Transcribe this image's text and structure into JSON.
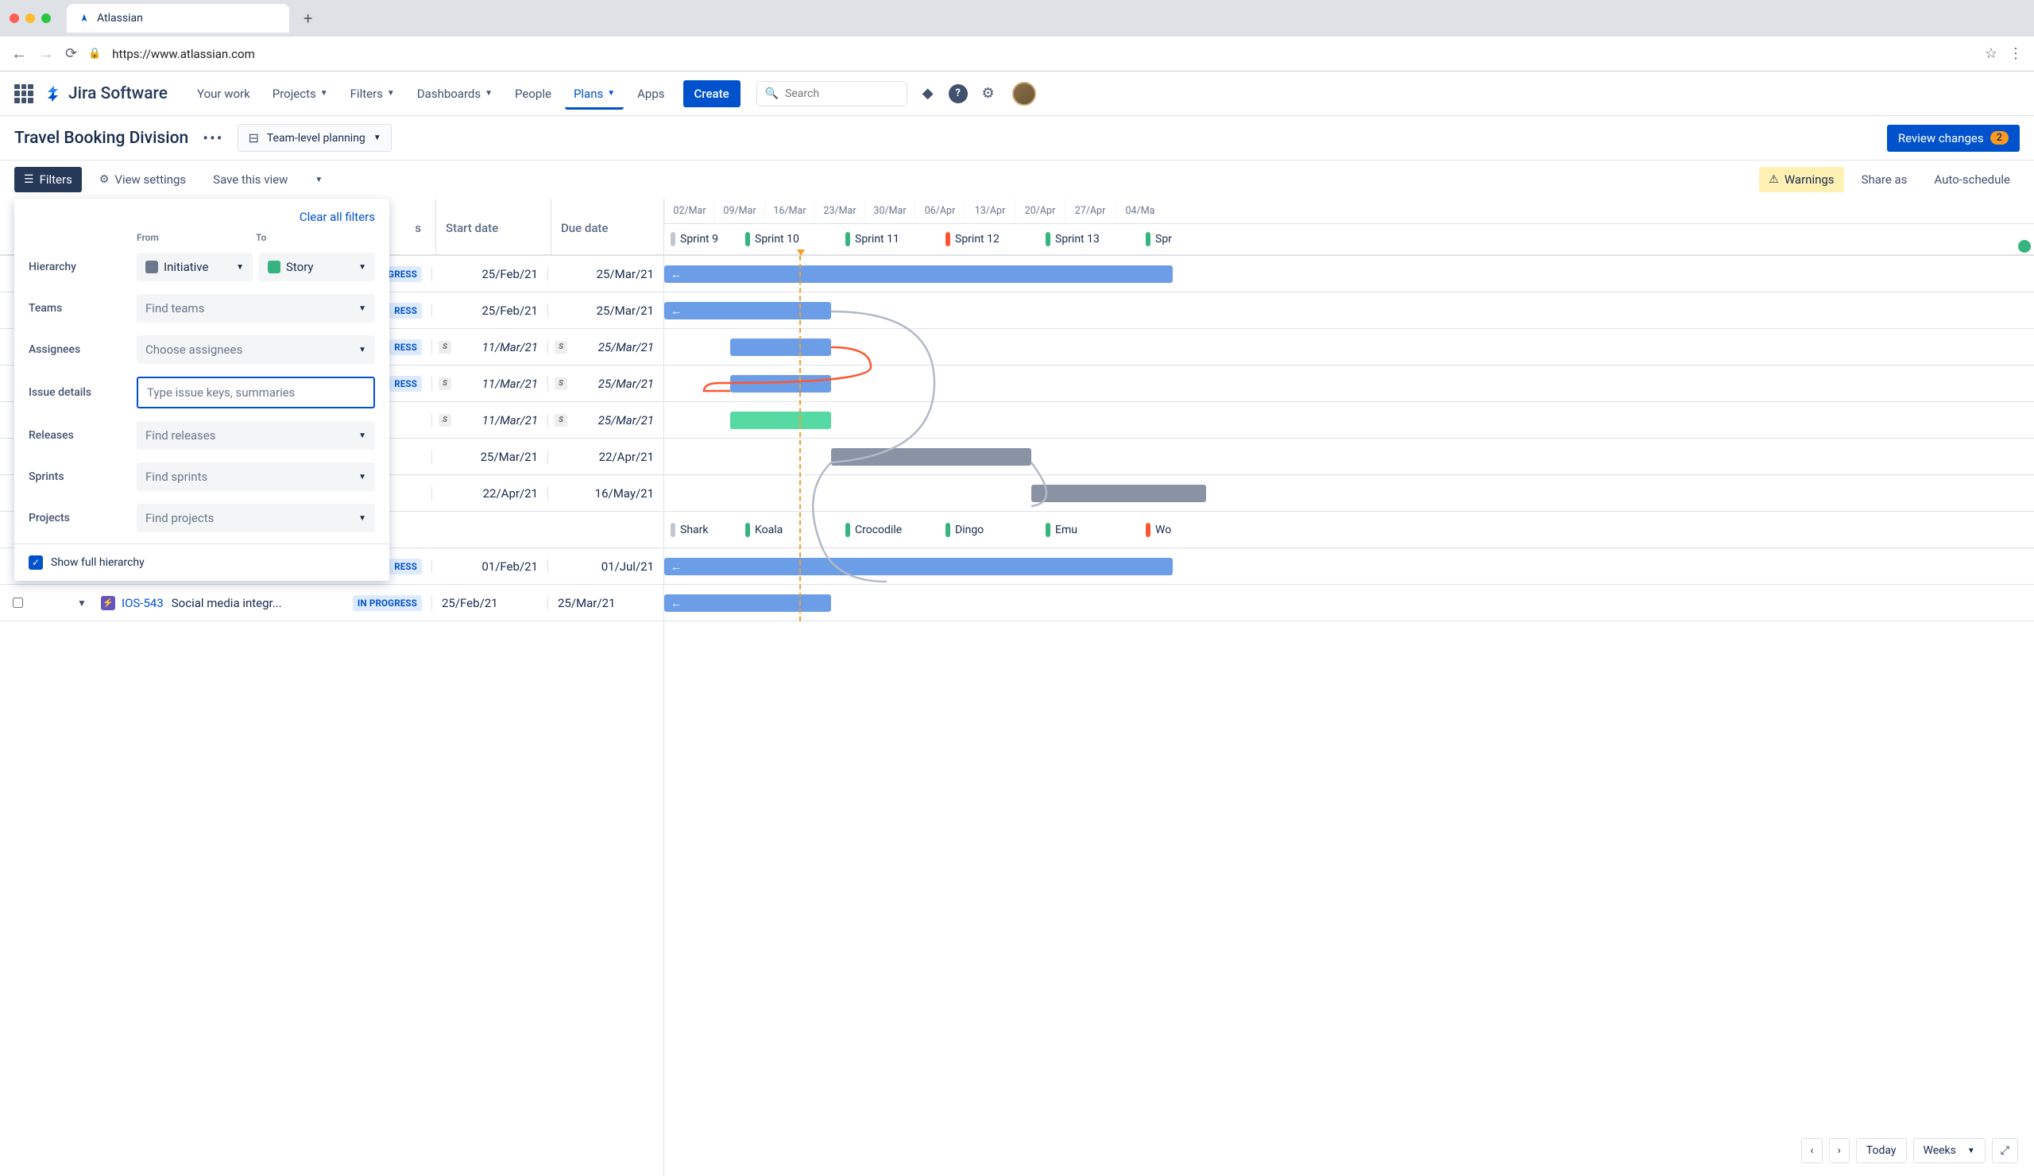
{
  "browser": {
    "tab_title": "Atlassian",
    "url": "https://www.atlassian.com"
  },
  "header": {
    "app_name": "Jira Software",
    "nav": {
      "your_work": "Your work",
      "projects": "Projects",
      "filters": "Filters",
      "dashboards": "Dashboards",
      "people": "People",
      "plans": "Plans",
      "apps": "Apps"
    },
    "create": "Create",
    "search_placeholder": "Search"
  },
  "project": {
    "title": "Travel Booking Division",
    "plan_mode": "Team-level planning",
    "review_label": "Review changes",
    "review_count": "2"
  },
  "toolbar": {
    "filters": "Filters",
    "view_settings": "View settings",
    "save_view": "Save this view",
    "warnings": "Warnings",
    "share_as": "Share as",
    "auto_schedule": "Auto-schedule"
  },
  "filter_panel": {
    "clear": "Clear all filters",
    "from_label": "From",
    "to_label": "To",
    "hierarchy": "Hierarchy",
    "hierarchy_from": "Initiative",
    "hierarchy_to": "Story",
    "teams": "Teams",
    "teams_ph": "Find teams",
    "assignees": "Assignees",
    "assignees_ph": "Choose assignees",
    "issue_details": "Issue details",
    "issue_ph": "Type issue keys, summaries",
    "releases": "Releases",
    "releases_ph": "Find releases",
    "sprints": "Sprints",
    "sprints_ph": "Find sprints",
    "projects": "Projects",
    "projects_ph": "Find projects",
    "show_full": "Show full hierarchy"
  },
  "columns": {
    "status_suffix": "s",
    "start": "Start date",
    "due": "Due date"
  },
  "timeline": {
    "dates": [
      "02/Mar",
      "09/Mar",
      "16/Mar",
      "23/Mar",
      "30/Mar",
      "06/Apr",
      "13/Apr",
      "20/Apr",
      "27/Apr",
      "04/Ma"
    ],
    "sprints_a": [
      "Sprint 9",
      "Sprint 10",
      "Sprint 11",
      "Sprint 12",
      "Sprint 13",
      "Spr"
    ],
    "sprints_b": [
      "Shark",
      "Koala",
      "Crocodile",
      "Dingo",
      "Emu",
      "Wo"
    ]
  },
  "rows": [
    {
      "status": "IN PROGRESS",
      "start": "25/Feb/21",
      "due": "25/Mar/21",
      "italic": false,
      "sprint_badge": false
    },
    {
      "status": "RESS",
      "start": "25/Feb/21",
      "due": "25/Mar/21",
      "italic": false,
      "sprint_badge": false
    },
    {
      "status": "RESS",
      "start": "11/Mar/21",
      "due": "25/Mar/21",
      "italic": true,
      "sprint_badge": true
    },
    {
      "status": "RESS",
      "start": "11/Mar/21",
      "due": "25/Mar/21",
      "italic": true,
      "sprint_badge": true
    },
    {
      "status": "",
      "start": "11/Mar/21",
      "due": "25/Mar/21",
      "italic": true,
      "sprint_badge": true
    },
    {
      "status": "",
      "start": "25/Mar/21",
      "due": "22/Apr/21",
      "italic": false,
      "sprint_badge": false
    },
    {
      "status": "",
      "start": "22/Apr/21",
      "due": "16/May/21",
      "italic": false,
      "sprint_badge": false
    },
    {
      "status": "",
      "start": "",
      "due": "",
      "italic": false,
      "sprint_badge": false
    },
    {
      "status": "RESS",
      "start": "01/Feb/21",
      "due": "01/Jul/21",
      "italic": false,
      "sprint_badge": false
    }
  ],
  "visible_row": {
    "key": "IOS-543",
    "summary": "Social media integr...",
    "status": "IN PROGRESS",
    "start": "25/Feb/21",
    "due": "25/Mar/21"
  },
  "bottom": {
    "today": "Today",
    "weeks": "Weeks"
  }
}
